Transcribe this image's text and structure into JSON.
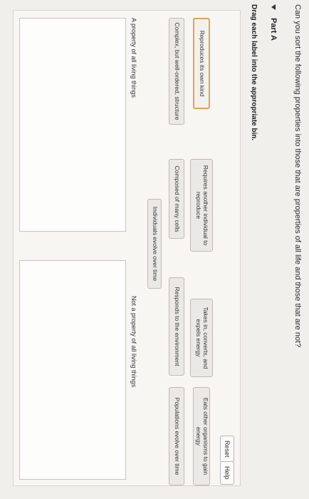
{
  "question": "Can you sort the following properties into those that are properties of all life and those that are not?",
  "part_label": "Part A",
  "instruction": "Drag each label into the appropriate bin.",
  "buttons": {
    "reset": "Reset",
    "help": "Help"
  },
  "labels": [
    "Reproduces its own kind",
    "Requires another individual to reproduce",
    "Takes in, converts, and expels energy",
    "Eats other organisms to gain energy",
    "Complex, but well-ordered, structure",
    "Composed of many cells",
    "Responds to the environment",
    "Populations evolve over time",
    "Individuals evolve over time"
  ],
  "bins": {
    "left": "A property of all living things",
    "right": "Not a property of all living things"
  },
  "colors": {
    "selected_border": "#e0a25b",
    "background": "#f1efeb"
  }
}
